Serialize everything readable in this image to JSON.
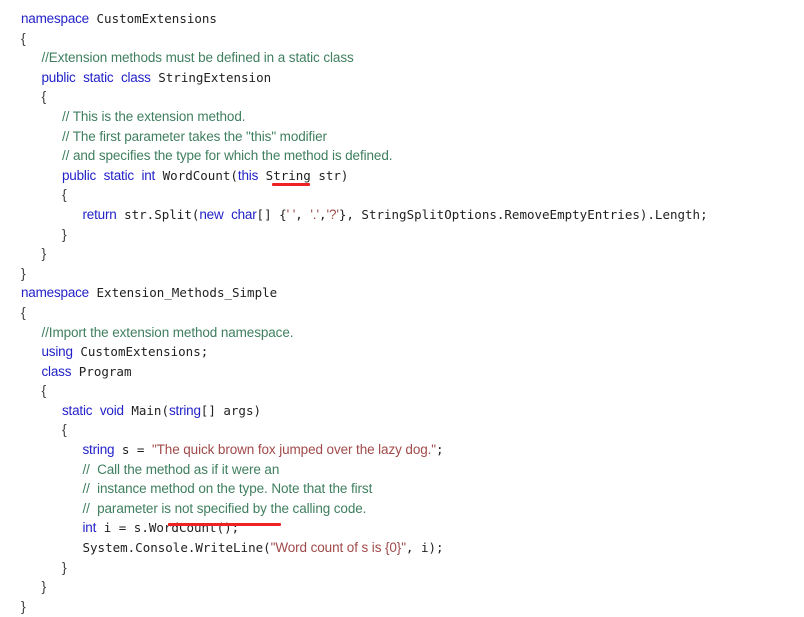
{
  "document": {
    "kind": "code-listing",
    "language": "C#",
    "background_color": "#ffffff"
  },
  "colors": {
    "keyword": "#2222c8",
    "comment": "#3f7f5f",
    "string": "#a14a4a",
    "identifier": "#1f1f1f",
    "annotation_underline": "#ee2222"
  },
  "annotations": [
    {
      "name": "this-keyword-underline",
      "target": "this",
      "color": "#ee2222"
    },
    {
      "name": "wordcount-call-underline",
      "target": "s.WordCount();",
      "color": "#ee2222"
    }
  ],
  "code": {
    "lines": [
      {
        "indent": 0,
        "tokens": [
          {
            "t": "kw",
            "v": "namespace"
          },
          {
            "t": "pn",
            "v": " "
          },
          {
            "t": "id",
            "v": "CustomExtensions"
          }
        ]
      },
      {
        "indent": 0,
        "tokens": [
          {
            "t": "br",
            "v": "{"
          }
        ]
      },
      {
        "indent": 1,
        "tokens": [
          {
            "t": "cm",
            "v": "//Extension methods must be defined in a static class"
          }
        ]
      },
      {
        "indent": 1,
        "tokens": [
          {
            "t": "kw",
            "v": "public"
          },
          {
            "t": "pn",
            "v": " "
          },
          {
            "t": "kw",
            "v": "static"
          },
          {
            "t": "pn",
            "v": " "
          },
          {
            "t": "kw",
            "v": "class"
          },
          {
            "t": "pn",
            "v": " "
          },
          {
            "t": "id",
            "v": "StringExtension"
          }
        ]
      },
      {
        "indent": 1,
        "tokens": [
          {
            "t": "br",
            "v": "{"
          }
        ]
      },
      {
        "indent": 2,
        "tokens": [
          {
            "t": "cm",
            "v": "// This is the extension method."
          }
        ]
      },
      {
        "indent": 2,
        "tokens": [
          {
            "t": "cm",
            "v": "// The first parameter takes the \"this\" modifier"
          }
        ]
      },
      {
        "indent": 2,
        "tokens": [
          {
            "t": "cm",
            "v": "// and specifies the type for which the method is defined."
          }
        ]
      },
      {
        "indent": 2,
        "tokens": [
          {
            "t": "kw",
            "v": "public"
          },
          {
            "t": "pn",
            "v": " "
          },
          {
            "t": "kw",
            "v": "static"
          },
          {
            "t": "pn",
            "v": " "
          },
          {
            "t": "kw",
            "v": "int"
          },
          {
            "t": "pn",
            "v": " "
          },
          {
            "t": "id",
            "v": "WordCount("
          },
          {
            "t": "kw",
            "v": "this"
          },
          {
            "t": "pn",
            "v": " "
          },
          {
            "t": "id",
            "v": "String str)"
          }
        ]
      },
      {
        "indent": 2,
        "tokens": [
          {
            "t": "br",
            "v": "{"
          }
        ]
      },
      {
        "indent": 3,
        "tokens": [
          {
            "t": "kw",
            "v": "return"
          },
          {
            "t": "pn",
            "v": " "
          },
          {
            "t": "id",
            "v": "str.Split("
          },
          {
            "t": "kw",
            "v": "new"
          },
          {
            "t": "pn",
            "v": " "
          },
          {
            "t": "kw",
            "v": "char"
          },
          {
            "t": "id",
            "v": "[] {"
          },
          {
            "t": "st",
            "v": "' '"
          },
          {
            "t": "id",
            "v": ", "
          },
          {
            "t": "st",
            "v": "'.'"
          },
          {
            "t": "id",
            "v": ","
          },
          {
            "t": "st",
            "v": "'?'"
          },
          {
            "t": "id",
            "v": "}, StringSplitOptions.RemoveEmptyEntries).Length;"
          }
        ]
      },
      {
        "indent": 2,
        "tokens": [
          {
            "t": "br",
            "v": "}"
          }
        ]
      },
      {
        "indent": 1,
        "tokens": [
          {
            "t": "br",
            "v": "}"
          }
        ]
      },
      {
        "indent": 0,
        "tokens": [
          {
            "t": "br",
            "v": "}"
          }
        ]
      },
      {
        "indent": 0,
        "tokens": [
          {
            "t": "kw",
            "v": "namespace"
          },
          {
            "t": "pn",
            "v": " "
          },
          {
            "t": "id",
            "v": "Extension_Methods_Simple"
          }
        ]
      },
      {
        "indent": 0,
        "tokens": [
          {
            "t": "br",
            "v": "{"
          }
        ]
      },
      {
        "indent": 1,
        "tokens": [
          {
            "t": "cm",
            "v": "//Import the extension method namespace."
          }
        ]
      },
      {
        "indent": 1,
        "tokens": [
          {
            "t": "kw",
            "v": "using"
          },
          {
            "t": "pn",
            "v": " "
          },
          {
            "t": "id",
            "v": "CustomExtensions;"
          }
        ]
      },
      {
        "indent": 1,
        "tokens": [
          {
            "t": "kw",
            "v": "class"
          },
          {
            "t": "pn",
            "v": " "
          },
          {
            "t": "id",
            "v": "Program"
          }
        ]
      },
      {
        "indent": 1,
        "tokens": [
          {
            "t": "br",
            "v": "{"
          }
        ]
      },
      {
        "indent": 2,
        "tokens": [
          {
            "t": "kw",
            "v": "static"
          },
          {
            "t": "pn",
            "v": " "
          },
          {
            "t": "kw",
            "v": "void"
          },
          {
            "t": "pn",
            "v": " "
          },
          {
            "t": "id",
            "v": "Main("
          },
          {
            "t": "kw",
            "v": "string"
          },
          {
            "t": "id",
            "v": "[] args)"
          }
        ]
      },
      {
        "indent": 2,
        "tokens": [
          {
            "t": "br",
            "v": "{"
          }
        ]
      },
      {
        "indent": 3,
        "tokens": [
          {
            "t": "kw",
            "v": "string"
          },
          {
            "t": "pn",
            "v": " "
          },
          {
            "t": "id",
            "v": "s = "
          },
          {
            "t": "st",
            "v": "\"The quick brown fox jumped over the lazy dog.\""
          },
          {
            "t": "id",
            "v": ";"
          }
        ]
      },
      {
        "indent": 3,
        "tokens": [
          {
            "t": "cm",
            "v": "//  Call the method as if it were an"
          }
        ]
      },
      {
        "indent": 3,
        "tokens": [
          {
            "t": "cm",
            "v": "//  instance method on the type. Note that the first"
          }
        ]
      },
      {
        "indent": 3,
        "tokens": [
          {
            "t": "cm",
            "v": "//  parameter is not specified by the calling code."
          }
        ]
      },
      {
        "indent": 3,
        "tokens": [
          {
            "t": "kw",
            "v": "int"
          },
          {
            "t": "pn",
            "v": " "
          },
          {
            "t": "id",
            "v": "i = s.WordCount();"
          }
        ]
      },
      {
        "indent": 3,
        "tokens": [
          {
            "t": "id",
            "v": "System.Console.WriteLine("
          },
          {
            "t": "st",
            "v": "\"Word count of s is {0}\""
          },
          {
            "t": "id",
            "v": ", i);"
          }
        ]
      },
      {
        "indent": 2,
        "tokens": [
          {
            "t": "br",
            "v": "}"
          }
        ]
      },
      {
        "indent": 1,
        "tokens": [
          {
            "t": "br",
            "v": "}"
          }
        ]
      },
      {
        "indent": 0,
        "tokens": [
          {
            "t": "br",
            "v": "}"
          }
        ]
      }
    ]
  }
}
